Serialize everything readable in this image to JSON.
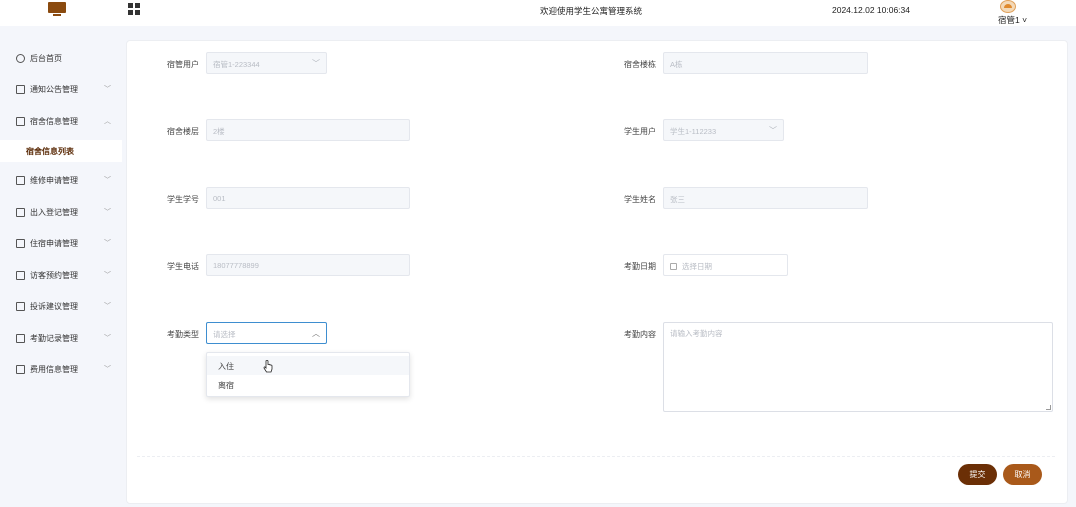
{
  "header": {
    "title": "欢迎使用学生公寓管理系统",
    "datetime": "2024.12.02 10:06:34",
    "user": "宿管1"
  },
  "sidebar": {
    "items": [
      {
        "label": "后台首页"
      },
      {
        "label": "通知公告管理"
      },
      {
        "label": "宿舍信息管理"
      },
      {
        "label": "维修申请管理"
      },
      {
        "label": "出入登记管理"
      },
      {
        "label": "住宿申请管理"
      },
      {
        "label": "访客预约管理"
      },
      {
        "label": "投诉建议管理"
      },
      {
        "label": "考勤记录管理"
      },
      {
        "label": "费用信息管理"
      }
    ],
    "active_sub": "宿舍信息列表"
  },
  "form": {
    "dorm_manager": {
      "label": "宿管用户",
      "value": "宿管1-223344"
    },
    "dorm_building": {
      "label": "宿舍楼栋",
      "value": "A栋"
    },
    "dorm_floor": {
      "label": "宿舍楼层",
      "value": "2楼"
    },
    "student_user": {
      "label": "学生用户",
      "value": "学生1-112233"
    },
    "student_id": {
      "label": "学生学号",
      "value": "001"
    },
    "student_name": {
      "label": "学生姓名",
      "value": "张三"
    },
    "student_phone": {
      "label": "学生电话",
      "value": "18077778899"
    },
    "attendance_date": {
      "label": "考勤日期",
      "placeholder": "选择日期"
    },
    "attendance_type": {
      "label": "考勤类型",
      "placeholder": "请选择",
      "options": [
        "入住",
        "离宿"
      ]
    },
    "attendance_content": {
      "label": "考勤内容",
      "placeholder": "请输入考勤内容"
    }
  },
  "buttons": {
    "submit": "提交",
    "cancel": "取消"
  },
  "colors": {
    "primary": "#6b2f06",
    "secondary": "#a9591a",
    "focus": "#3e8ed0"
  }
}
